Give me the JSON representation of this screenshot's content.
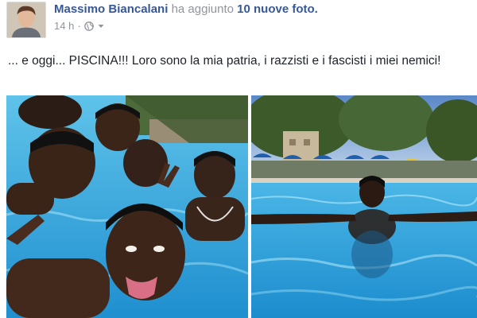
{
  "post": {
    "author": {
      "name": "Massimo Biancalani",
      "action": "ha aggiunto",
      "count": "10 nuove foto."
    },
    "meta": {
      "time": "14 h",
      "separator": "·",
      "privacy_icon": "globe-icon",
      "menu_icon": "chevron-down-icon"
    },
    "text": "... e oggi... PISCINA!!! Loro sono la mia patria, i razzisti e i fascisti i miei nemici!",
    "photos": [
      {
        "icon": "photo-group-selfie-pool"
      },
      {
        "icon": "photo-man-swimming-pool"
      }
    ]
  },
  "colors": {
    "link": "#365899",
    "muted": "#90949c",
    "text": "#1d2129",
    "water": "#2a9fd8"
  }
}
